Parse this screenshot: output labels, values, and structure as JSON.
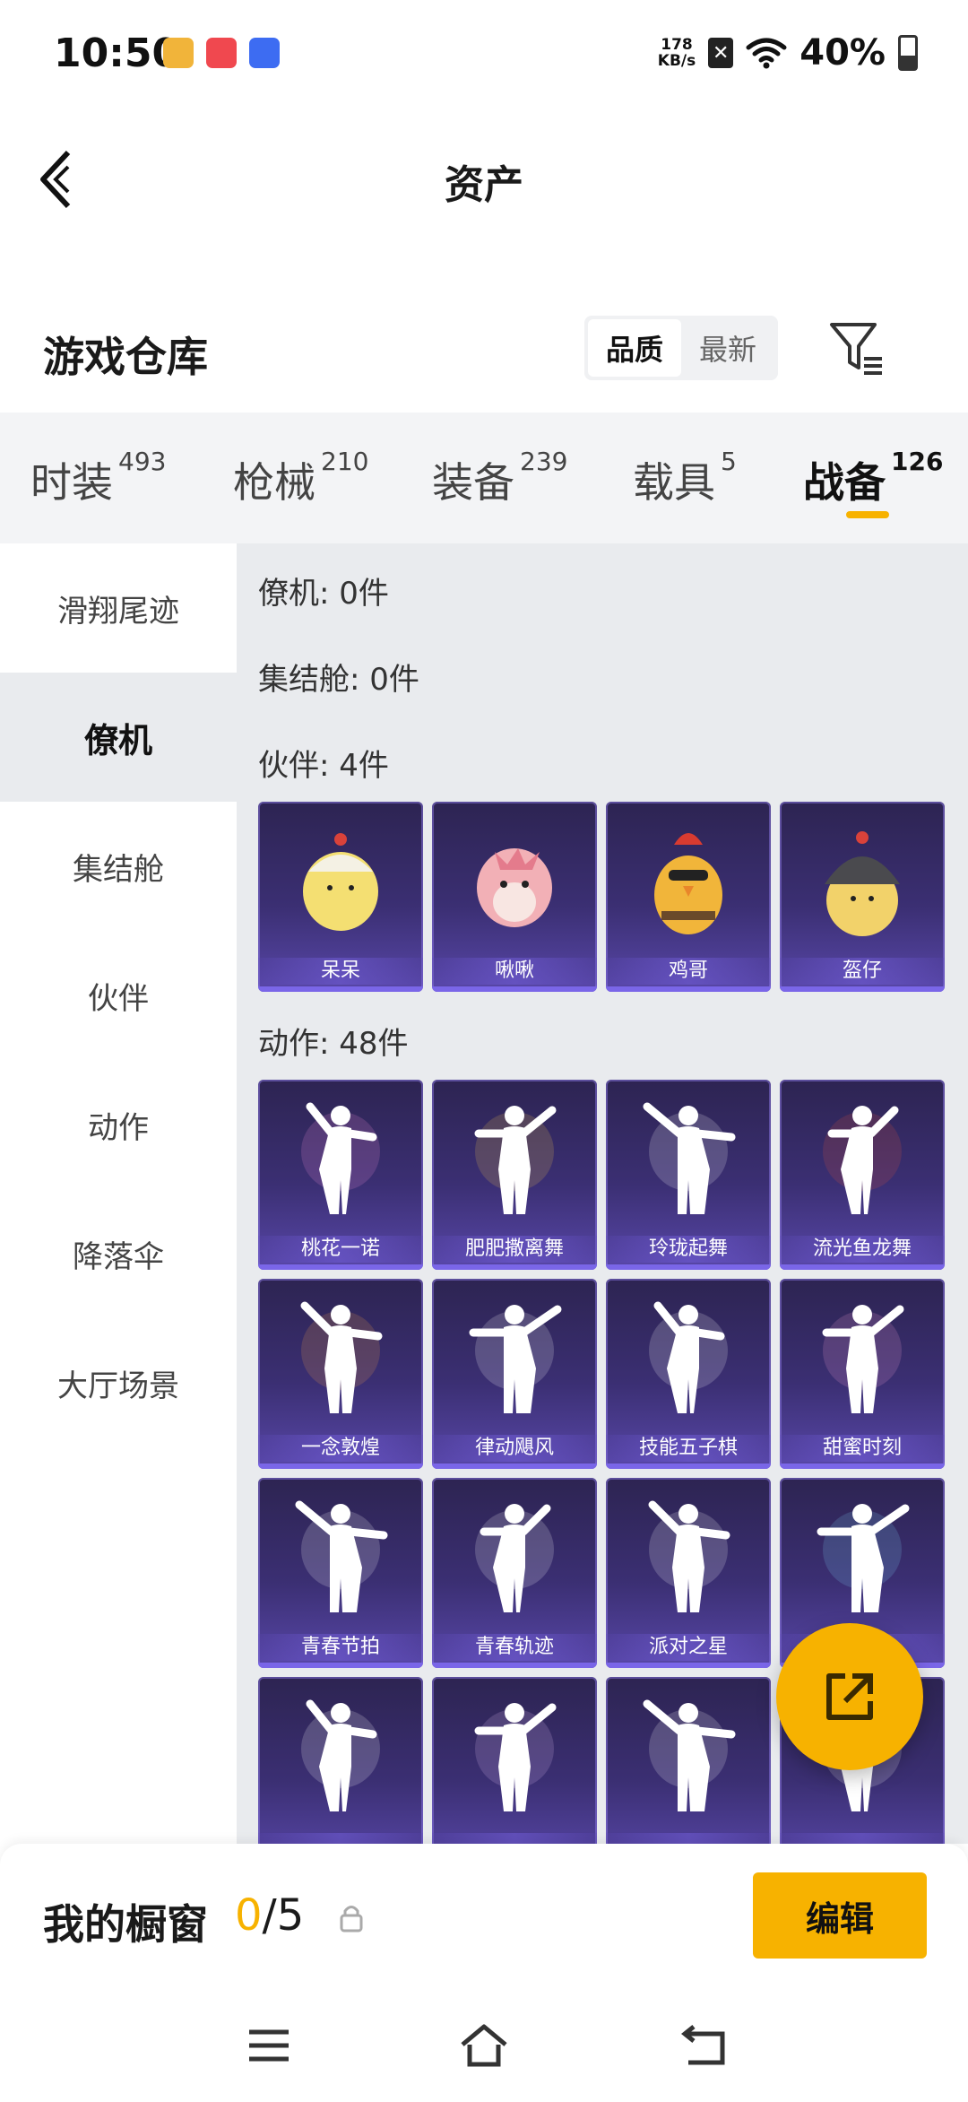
{
  "status_bar": {
    "time": "10:50",
    "net_speed_value": "178",
    "net_speed_unit": "KB/s",
    "battery_text": "40%",
    "battery_level": 0.4,
    "app_icons": [
      {
        "name": "game-app-icon",
        "color": "#f1b43a"
      },
      {
        "name": "huawei-app-icon",
        "color": "#f0484f"
      },
      {
        "name": "vivo-app-icon",
        "color": "#3d6cf2"
      }
    ]
  },
  "header": {
    "title": "资产"
  },
  "warehouse": {
    "title": "游戏仓库",
    "sort_options": [
      {
        "label": "品质",
        "active": true
      },
      {
        "label": "最新",
        "active": false
      }
    ]
  },
  "category_tabs": [
    {
      "label": "时装",
      "count": "493"
    },
    {
      "label": "枪械",
      "count": "210"
    },
    {
      "label": "装备",
      "count": "239"
    },
    {
      "label": "载具",
      "count": "5"
    },
    {
      "label": "战备",
      "count": "126",
      "active": true
    }
  ],
  "sidebar": {
    "items": [
      {
        "label": "滑翔尾迹"
      },
      {
        "label": "僚机",
        "active": true
      },
      {
        "label": "集结舱"
      },
      {
        "label": "伙伴"
      },
      {
        "label": "动作"
      },
      {
        "label": "降落伞"
      },
      {
        "label": "大厅场景"
      }
    ]
  },
  "sections": {
    "wingman": "僚机: 0件",
    "capsule": "集结舱: 0件",
    "partner": "伙伴: 4件",
    "emote": "动作: 48件"
  },
  "partners": [
    {
      "label": "呆呆"
    },
    {
      "label": "啾啾"
    },
    {
      "label": "鸡哥"
    },
    {
      "label": "盔仔"
    }
  ],
  "emotes": [
    {
      "label": "桃花一诺"
    },
    {
      "label": "肥肥撒离舞"
    },
    {
      "label": "玲珑起舞"
    },
    {
      "label": "流光鱼龙舞"
    },
    {
      "label": "一念敦煌"
    },
    {
      "label": "律动飓风"
    },
    {
      "label": "技能五子棋"
    },
    {
      "label": "甜蜜时刻"
    },
    {
      "label": "青春节拍"
    },
    {
      "label": "青春轨迹"
    },
    {
      "label": "派对之星"
    },
    {
      "label": ""
    },
    {
      "label": ""
    },
    {
      "label": ""
    },
    {
      "label": ""
    },
    {
      "label": ""
    }
  ],
  "showcase": {
    "title": "我的橱窗",
    "current": "0",
    "separator_total": "/5",
    "edit_label": "编辑"
  },
  "colors": {
    "accent": "#f7b200",
    "card_top": "#2d2452",
    "card_bottom": "#5847a8"
  }
}
